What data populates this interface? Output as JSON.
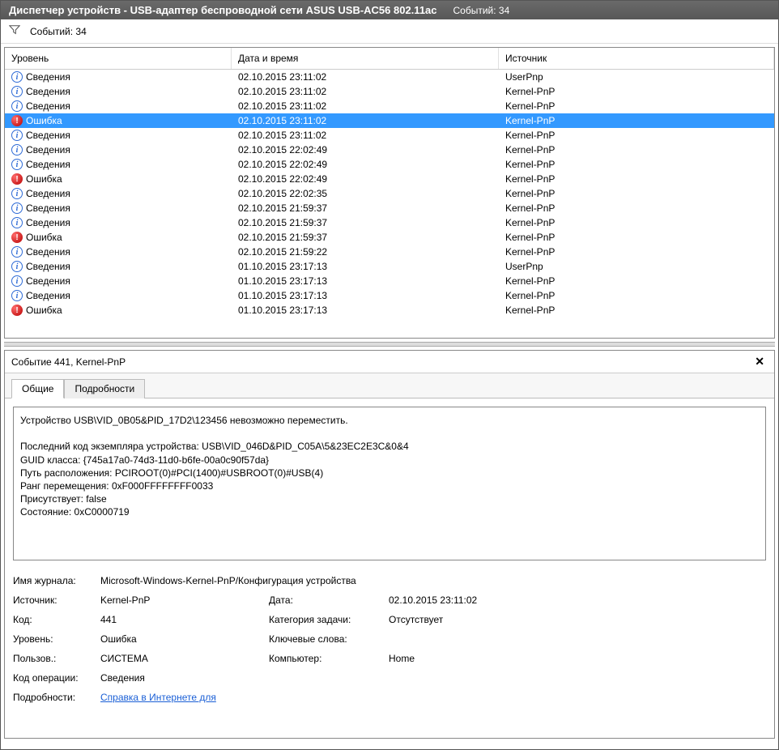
{
  "window": {
    "title_prefix": "Диспетчер устройств - ",
    "device_name": "USB-адаптер беспроводной сети ASUS USB-AC56 802.11ac",
    "events_label": "Событий: 34"
  },
  "filter": {
    "events_label": "Событий: 34"
  },
  "columns": {
    "level": "Уровень",
    "date": "Дата и время",
    "source": "Источник"
  },
  "events": [
    {
      "type": "info",
      "level": "Сведения",
      "date": "02.10.2015 23:11:02",
      "source": "UserPnp",
      "selected": false
    },
    {
      "type": "info",
      "level": "Сведения",
      "date": "02.10.2015 23:11:02",
      "source": "Kernel-PnP",
      "selected": false
    },
    {
      "type": "info",
      "level": "Сведения",
      "date": "02.10.2015 23:11:02",
      "source": "Kernel-PnP",
      "selected": false
    },
    {
      "type": "error",
      "level": "Ошибка",
      "date": "02.10.2015 23:11:02",
      "source": "Kernel-PnP",
      "selected": true
    },
    {
      "type": "info",
      "level": "Сведения",
      "date": "02.10.2015 23:11:02",
      "source": "Kernel-PnP",
      "selected": false
    },
    {
      "type": "info",
      "level": "Сведения",
      "date": "02.10.2015 22:02:49",
      "source": "Kernel-PnP",
      "selected": false
    },
    {
      "type": "info",
      "level": "Сведения",
      "date": "02.10.2015 22:02:49",
      "source": "Kernel-PnP",
      "selected": false
    },
    {
      "type": "error",
      "level": "Ошибка",
      "date": "02.10.2015 22:02:49",
      "source": "Kernel-PnP",
      "selected": false
    },
    {
      "type": "info",
      "level": "Сведения",
      "date": "02.10.2015 22:02:35",
      "source": "Kernel-PnP",
      "selected": false
    },
    {
      "type": "info",
      "level": "Сведения",
      "date": "02.10.2015 21:59:37",
      "source": "Kernel-PnP",
      "selected": false
    },
    {
      "type": "info",
      "level": "Сведения",
      "date": "02.10.2015 21:59:37",
      "source": "Kernel-PnP",
      "selected": false
    },
    {
      "type": "error",
      "level": "Ошибка",
      "date": "02.10.2015 21:59:37",
      "source": "Kernel-PnP",
      "selected": false
    },
    {
      "type": "info",
      "level": "Сведения",
      "date": "02.10.2015 21:59:22",
      "source": "Kernel-PnP",
      "selected": false
    },
    {
      "type": "info",
      "level": "Сведения",
      "date": "01.10.2015 23:17:13",
      "source": "UserPnp",
      "selected": false
    },
    {
      "type": "info",
      "level": "Сведения",
      "date": "01.10.2015 23:17:13",
      "source": "Kernel-PnP",
      "selected": false
    },
    {
      "type": "info",
      "level": "Сведения",
      "date": "01.10.2015 23:17:13",
      "source": "Kernel-PnP",
      "selected": false
    },
    {
      "type": "error",
      "level": "Ошибка",
      "date": "01.10.2015 23:17:13",
      "source": "Kernel-PnP",
      "selected": false
    }
  ],
  "details": {
    "header": "Событие 441, Kernel-PnP",
    "tabs": {
      "general": "Общие",
      "details": "Подробности"
    },
    "message": "Устройство USB\\VID_0B05&PID_17D2\\123456 невозможно переместить.\n\nПоследний код экземпляра устройства: USB\\VID_046D&PID_C05A\\5&23EC2E3C&0&4\nGUID класса: {745a17a0-74d3-11d0-b6fe-00a0c90f57da}\nПуть расположения: PCIROOT(0)#PCI(1400)#USBROOT(0)#USB(4)\nРанг перемещения: 0xF000FFFFFFFF0033\nПрисутствует: false\nСостояние: 0xC0000719",
    "props": {
      "log_name_label": "Имя журнала:",
      "log_name": "Microsoft-Windows-Kernel-PnP/Конфигурация устройства",
      "source_label": "Источник:",
      "source": "Kernel-PnP",
      "date_label": "Дата:",
      "date": "02.10.2015 23:11:02",
      "code_label": "Код:",
      "code": "441",
      "task_label": "Категория задачи:",
      "task": "Отсутствует",
      "level_label": "Уровень:",
      "level": "Ошибка",
      "keywords_label": "Ключевые слова:",
      "keywords": "",
      "user_label": "Пользов.:",
      "user": "СИСТЕМА",
      "computer_label": "Компьютер:",
      "computer": "Home",
      "opcode_label": "Код операции:",
      "opcode": "Сведения",
      "moreinfo_label": "Подробности:",
      "moreinfo_link": "Справка в Интернете для "
    }
  }
}
